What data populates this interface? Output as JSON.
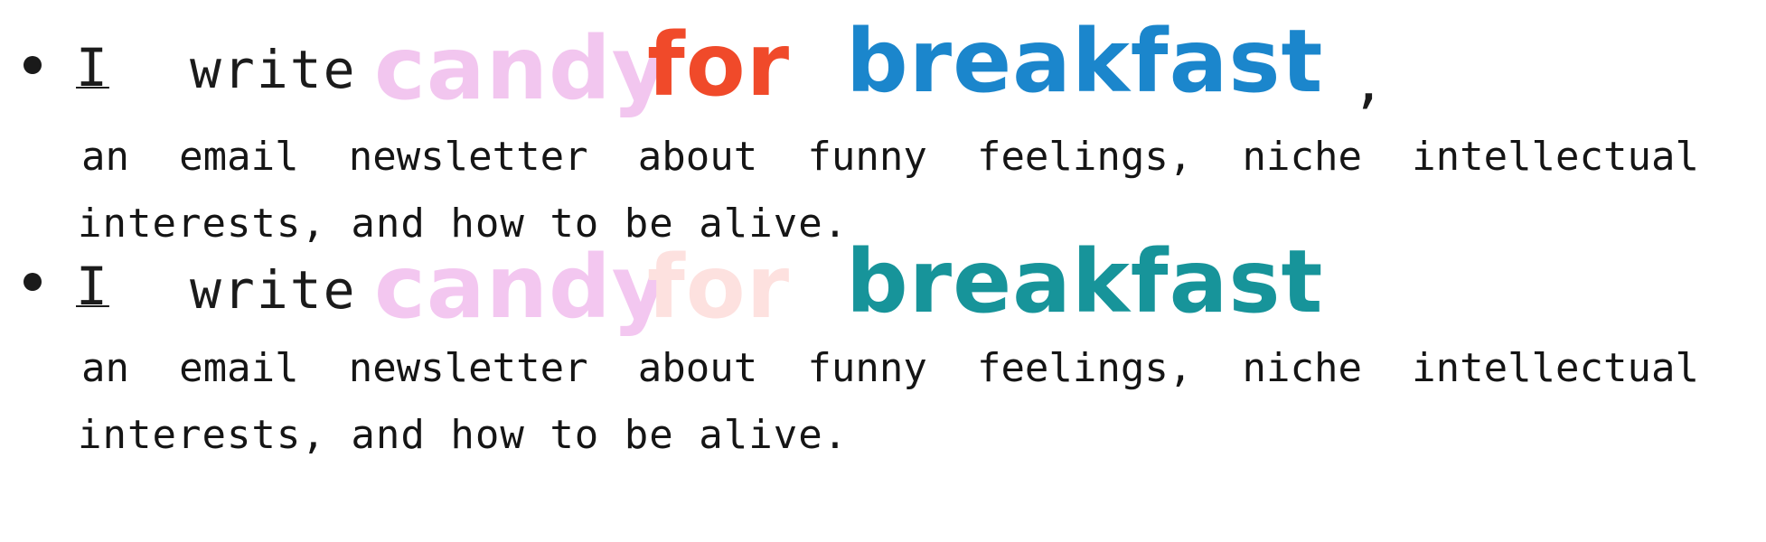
{
  "items": [
    {
      "headline": {
        "i": "I",
        "write": "write",
        "candy": "candy",
        "for": "for",
        "breakfast": "breakfast",
        "comma": ","
      },
      "line1_words": [
        "an",
        "email",
        "newsletter",
        "about",
        "funny",
        "feelings,",
        "niche",
        "intellectual"
      ],
      "line2": "interests, and how to be alive.",
      "colors": {
        "candy": "#f2c6ef",
        "for": "#f04a2a",
        "breakfast": "#1b86cc"
      }
    },
    {
      "headline": {
        "i": "I",
        "write": "write",
        "candy": "candy",
        "for": "for",
        "breakfast": "breakfast"
      },
      "line1_words": [
        "an",
        "email",
        "newsletter",
        "about",
        "funny",
        "feelings,",
        "niche",
        "intellectual"
      ],
      "line2": "interests, and how to be alive.",
      "colors": {
        "candy": "#f3c7f0",
        "for": "#fde1df",
        "breakfast": "#17949a"
      }
    }
  ]
}
